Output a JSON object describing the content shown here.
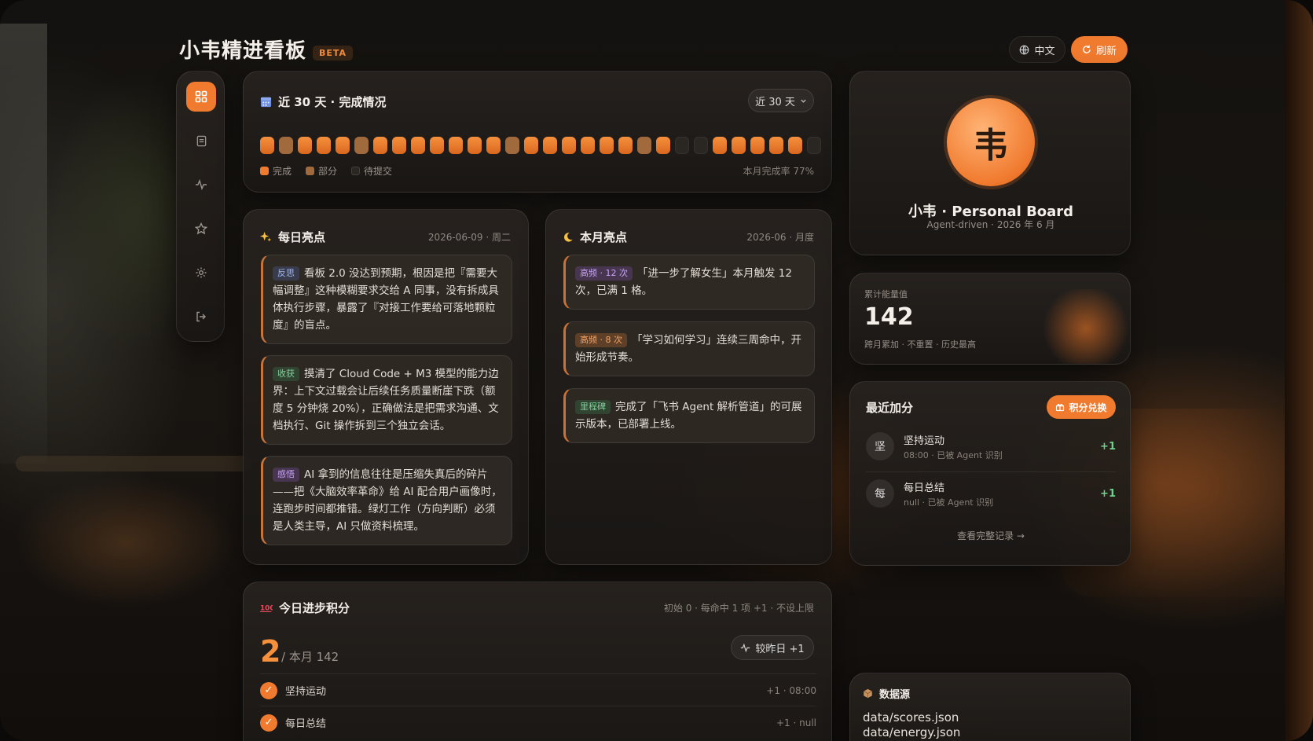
{
  "header": {
    "title": "小韦精进看板",
    "badge": "BETA",
    "lang_label": "中文",
    "refresh_label": "刷新"
  },
  "sidebar": {
    "items": [
      {
        "icon": "grid-icon",
        "active": true
      },
      {
        "icon": "document-icon",
        "active": false
      },
      {
        "icon": "activity-icon",
        "active": false
      },
      {
        "icon": "star-icon",
        "active": false
      },
      {
        "icon": "gear-icon",
        "active": false
      },
      {
        "icon": "logout-icon",
        "active": false
      }
    ]
  },
  "completion": {
    "title": "近 30 天 · 完成情况",
    "range_label": "近 30 天",
    "days": [
      "done",
      "partial",
      "done",
      "done",
      "done",
      "partial",
      "done",
      "done",
      "done",
      "done",
      "done",
      "done",
      "done",
      "partial",
      "done",
      "done",
      "done",
      "done",
      "done",
      "done",
      "partial",
      "done",
      "pending",
      "pending",
      "done",
      "done",
      "done",
      "done",
      "done",
      "pending"
    ],
    "legend": {
      "done": "完成",
      "partial": "部分",
      "pending": "待提交"
    },
    "rate_text": "本月完成率 77%",
    "colors": {
      "done": "#f07a2e",
      "partial": "#a06a3d",
      "pending": "#2a2622"
    }
  },
  "daily": {
    "title": "每日亮点",
    "date": "2026-06-09 · 周二",
    "notes": [
      {
        "tag": "反思",
        "text": "看板 2.0 没达到预期，根因是把『需要大幅调整』这种模糊要求交给 A 同事，没有拆成具体执行步骤，暴露了『对接工作要给可落地颗粒度』的盲点。"
      },
      {
        "tag": "收获",
        "text": "摸清了 Cloud Code + M3 模型的能力边界：上下文过载会让后续任务质量断崖下跌（额度 5 分钟烧 20%），正确做法是把需求沟通、文档执行、Git 操作拆到三个独立会话。"
      },
      {
        "tag": "感悟",
        "text": "AI 拿到的信息往往是压缩失真后的碎片——把《大脑效率革命》给 AI 配合用户画像时，连跑步时间都推错。绿灯工作（方向判断）必须是人类主导，AI 只做资料梳理。"
      }
    ]
  },
  "monthly": {
    "title": "本月亮点",
    "date": "2026-06 · 月度",
    "notes": [
      {
        "tag": "高频 · 12 次",
        "text": "「进一步了解女生」本月触发 12 次，已满 1 格。"
      },
      {
        "tag": "高频 · 8 次",
        "text": "「学习如何学习」连续三周命中，开始形成节奏。"
      },
      {
        "tag": "里程碑",
        "text": "完成了「飞书 Agent 解析管道」的可展示版本，已部署上线。"
      }
    ]
  },
  "today": {
    "title": "今日进步积分",
    "rule": "初始 0 · 每命中 1 项 +1 · 不设上限",
    "score": "2",
    "month_text": "/ 本月 142",
    "compare_label": "较昨日 +1",
    "tasks": [
      {
        "label": "坚持运动",
        "meta": "+1 · 08:00"
      },
      {
        "label": "每日总结",
        "meta": "+1 · null"
      }
    ]
  },
  "profile": {
    "avatar_char": "韦",
    "name": "小韦 · Personal Board",
    "sub": "Agent-driven · 2026 年 6 月"
  },
  "energy": {
    "label": "累计能量值",
    "value": "142",
    "note": "跨月累加 · 不重置 · 历史最高"
  },
  "recent": {
    "title": "最近加分",
    "redeem_label": "积分兑换",
    "items": [
      {
        "avatar": "坚",
        "title": "坚持运动",
        "meta": "08:00 · 已被 Agent 识别",
        "points": "+1"
      },
      {
        "avatar": "每",
        "title": "每日总结",
        "meta": "null · 已被 Agent 识别",
        "points": "+1"
      }
    ],
    "view_all": "查看完整记录 →"
  },
  "source": {
    "title": "数据源",
    "files": [
      "data/scores.json",
      "data/energy.json"
    ]
  },
  "accent": "#f07a2e"
}
